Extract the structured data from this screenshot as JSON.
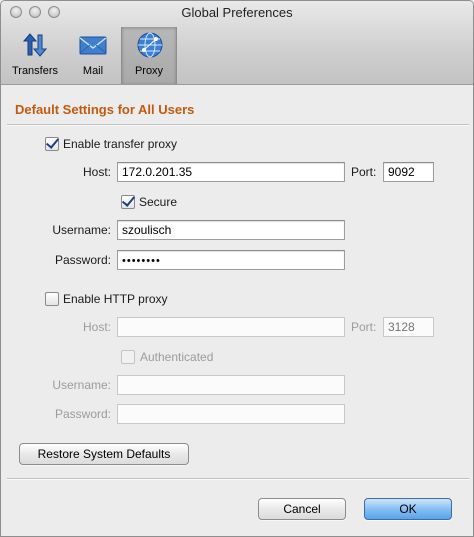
{
  "window": {
    "title": "Global Preferences"
  },
  "toolbar": {
    "items": [
      {
        "label": "Transfers",
        "icon": "transfer-arrows-icon",
        "selected": false
      },
      {
        "label": "Mail",
        "icon": "envelope-icon",
        "selected": false
      },
      {
        "label": "Proxy",
        "icon": "globe-icon",
        "selected": true
      }
    ]
  },
  "section": {
    "title": "Default Settings for All Users"
  },
  "transfer_proxy": {
    "enable_label": "Enable transfer proxy",
    "enabled": true,
    "host_label": "Host:",
    "host_value": "172.0.201.35",
    "port_label": "Port:",
    "port_value": "9092",
    "secure_label": "Secure",
    "secure": true,
    "username_label": "Username:",
    "username_value": "szoulisch",
    "password_label": "Password:",
    "password_value": "••••••••"
  },
  "http_proxy": {
    "enable_label": "Enable HTTP proxy",
    "enabled": false,
    "host_label": "Host:",
    "host_value": "",
    "port_label": "Port:",
    "port_placeholder": "3128",
    "authenticated_label": "Authenticated",
    "authenticated": false,
    "username_label": "Username:",
    "username_value": "",
    "password_label": "Password:",
    "password_value": ""
  },
  "buttons": {
    "restore_defaults": "Restore System Defaults",
    "cancel": "Cancel",
    "ok": "OK"
  },
  "colors": {
    "section_title": "#c35b0f",
    "primary_button": "#5aa4ea"
  }
}
